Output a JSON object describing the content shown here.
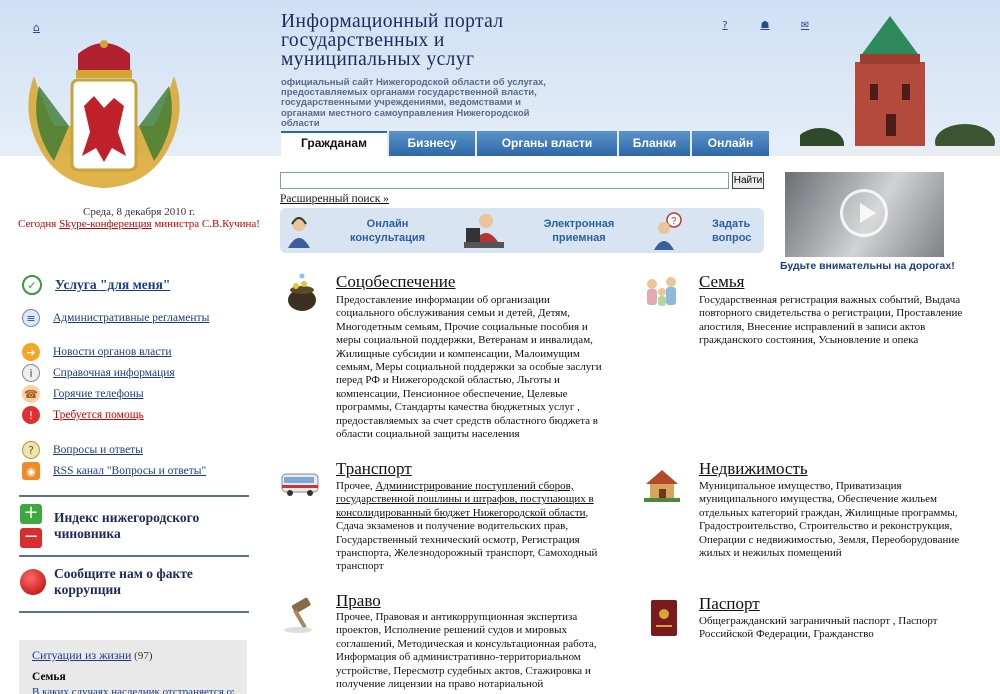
{
  "header": {
    "title": "Информационный портал государственных и муниципальных  услуг",
    "subtitle": "официальный сайт Нижегородской области об услугах, предоставляемых органами государственной власти, государственными учреждениями, ведомствами и органами местного самоуправления Нижегородской области",
    "icons": [
      "home-icon",
      "help-icon",
      "sitemap-icon",
      "mail-icon"
    ],
    "help_glyph": "?",
    "sitemap_glyph": "☗",
    "mail_glyph": "✉",
    "home_glyph": "⌂"
  },
  "tabs": [
    {
      "label": "Гражданам",
      "active": true
    },
    {
      "label": "Бизнесу",
      "active": false
    },
    {
      "label": "Органы власти",
      "active": false
    },
    {
      "label": "Бланки",
      "active": false
    },
    {
      "label": "Онлайн",
      "active": false
    }
  ],
  "date_line": "Среда, 8 декабря 2010 г.",
  "skype": {
    "prefix": "Сегодня ",
    "link": "Skype-конференция",
    "suffix": " министра С.В.Кучина!"
  },
  "left_nav": {
    "my_service": "Услуга \"для меня\"",
    "items": [
      "Административные регламенты",
      "Новости органов власти",
      "Справочная информация",
      "Горячие телефоны",
      "Требуется помощь",
      "Вопросы и ответы",
      "RSS канал \"Вопросы и ответы\""
    ],
    "index_promo": "Индекс нижегородского чиновника",
    "corruption_promo": "Сообщите нам о факте коррупции",
    "situations": {
      "title": "Ситуации из жизни",
      "count": "(97)",
      "category": "Семья",
      "text": "В каких случаях наследник отстраняется от"
    }
  },
  "search": {
    "value": "",
    "button": "Найти",
    "advanced": "Расширенный поиск »"
  },
  "services": [
    {
      "label": "Онлайн\nконсультация"
    },
    {
      "label": "Электронная\nприемная"
    },
    {
      "label": "Задать\nвопрос"
    }
  ],
  "video_caption": "Будьте внимательны на дорогах!",
  "categories": [
    {
      "title": "Соцобеспечение",
      "desc": "Предоставление информации об организации социального обслуживания семьи и детей, Детям, Многодетным семьям, Прочие социальные пособия и меры социальной поддержки, Ветеранам и инвалидам, Жилищные субсидии и компенсации, Малоимущим семьям, Меры социальной поддержки за особые заслуги перед РФ и Нижегородской областью, Льготы и компенсации, Пенсионное обеспечение, Целевые программы, Стандарты качества бюджетных услуг , предоставляемых за счет средств областного бюджета в области социальной защиты населения"
    },
    {
      "title": "Семья",
      "desc": "Государственная регистрация важных событий, Выдача повторного свидетельства о регистрации, Проставление апостиля, Внесение исправлений в записи актов гражданского состояния, Усыновление и опека"
    },
    {
      "title": "Транспорт",
      "desc_prefix": "Прочее, ",
      "desc_link": "Администрирование поступлений сборов, государственной пошлины и штрафов, поступающих в консолидированный бюджет Нижегородской области",
      "desc_suffix": ", Сдача экзаменов и получение водительских прав, Государственный технический осмотр, Регистрация транспорта, Железнодорожный транспорт, Самоходный транспорт"
    },
    {
      "title": "Недвижимость",
      "desc": "Муниципальное имущество, Приватизация муниципального имущества, Обеспечение жильем отдельных категорий граждан, Жилищные программы, Градостроительство, Строительство и реконструкция, Операции с недвижимостью, Земля, Переоборудование жилых и нежилых помещений"
    },
    {
      "title": "Право",
      "desc": "Прочее, Правовая и антикоррупционная экспертиза проектов, Исполнение решений судов и мировых соглашений, Методическая и консультационная работа, Информация об административно-территориальном устройстве, Пересмотр судебных актов, Стажировка и получение лицензии на право нотариальной"
    },
    {
      "title": "Паспорт",
      "desc": "Общегражданский заграничный паспорт , Паспорт Российской Федерации, Гражданство"
    }
  ],
  "colors": {
    "accent": "#2d67a8",
    "header_bg": "#dce8f6",
    "alert_red": "#cc0000"
  }
}
